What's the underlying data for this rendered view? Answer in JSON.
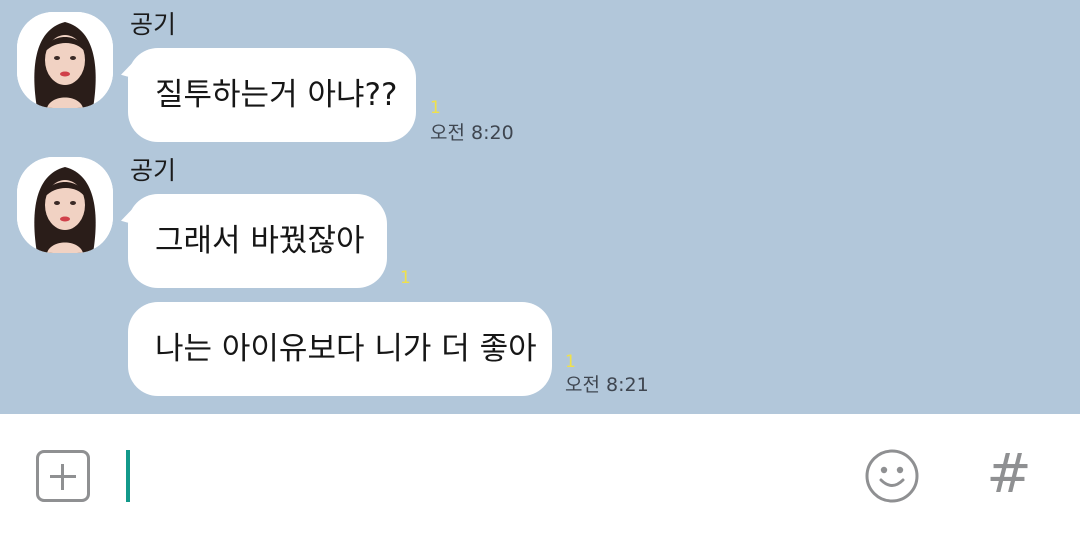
{
  "messages": [
    {
      "sender": "공기",
      "bubbles": [
        {
          "text": "질투하는거 아냐??",
          "unread": "1",
          "time": "오전 8:20"
        }
      ]
    },
    {
      "sender": "공기",
      "bubbles": [
        {
          "text": "그래서 바꿨잖아",
          "unread": "1",
          "time": ""
        },
        {
          "text": "나는 아이유보다 니가 더 좋아",
          "unread": "1",
          "time": "오전 8:21"
        }
      ]
    }
  ],
  "input_bar": {
    "plus_icon": "plus-square-icon",
    "emoji_icon": "smiley-icon",
    "hashtag_icon": "hashtag-icon",
    "hashtag_glyph": "#"
  },
  "colors": {
    "chat_background": "#b2c7da",
    "bubble": "#ffffff",
    "unread_count": "#f0e14a",
    "caret": "#12998a",
    "icon_gray": "#8f9092"
  }
}
